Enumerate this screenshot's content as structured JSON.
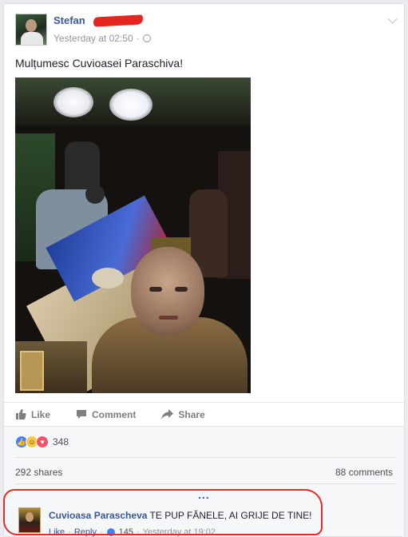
{
  "post": {
    "author": "Stefan",
    "timestamp": "Yesterday at 02:50",
    "text": "Mulțumesc Cuvioasei Paraschiva!"
  },
  "actions": {
    "like": "Like",
    "comment": "Comment",
    "share": "Share"
  },
  "reactions": {
    "count": "348"
  },
  "stats": {
    "shares": "292 shares",
    "comments": "88 comments"
  },
  "more_comments": "...",
  "comment": {
    "author": "Cuvioasa Parascheva",
    "text": "TE PUP FĂNELE, AI GRIJE DE TINE!",
    "like": "Like",
    "reply": "Reply",
    "likes": "145",
    "timestamp": "Yesterday at 19:02"
  },
  "colors": {
    "link": "#365899",
    "like_blue": "#4080ff",
    "highlight_red": "#e22b24"
  }
}
